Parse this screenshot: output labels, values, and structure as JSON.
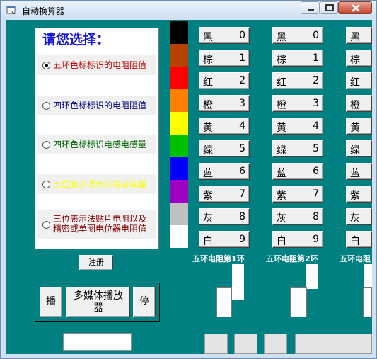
{
  "window": {
    "title": "自动换算器"
  },
  "choice_panel": {
    "title": "请您选择：",
    "options": [
      {
        "label": "五环色标标识的电阻阻值",
        "color": "#c00000",
        "selected": true
      },
      {
        "label": "四环色标标识的电阻阻值",
        "color": "#000080",
        "selected": false
      },
      {
        "label": "四环色标标识电感电感量",
        "color": "#006400",
        "selected": false
      },
      {
        "label": "三位表示法表示电容容量",
        "color": "#ffff00",
        "selected": false
      },
      {
        "label_line1": "三位表示法贴片电阻以及",
        "label_line2": "精密或单圈电位器电阻值",
        "color": "#800000",
        "selected": false
      }
    ]
  },
  "register_button": "注册",
  "media": {
    "play": "播",
    "multimedia_line1": "多媒体播放",
    "multimedia_line2": "器",
    "stop": "停"
  },
  "swatches": [
    "#000000",
    "#b84000",
    "#ff0000",
    "#ff8000",
    "#ffff00",
    "#00c000",
    "#0000ff",
    "#a000c0",
    "#c0c0c0",
    "#ffffff"
  ],
  "bands": {
    "names": [
      "黑",
      "棕",
      "红",
      "橙",
      "黄",
      "绿",
      "蓝",
      "紫",
      "灰",
      "白"
    ],
    "numbers": [
      "0",
      "1",
      "2",
      "3",
      "4",
      "5",
      "6",
      "7",
      "8",
      "9"
    ],
    "labels": [
      "五环电阻第1环",
      "五环电阻第2环",
      "五环电阻"
    ]
  }
}
